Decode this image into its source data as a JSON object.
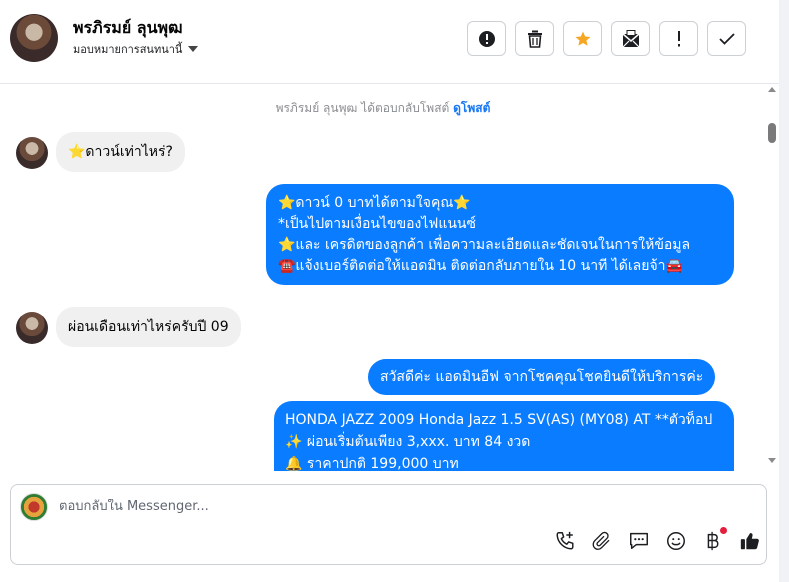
{
  "header": {
    "contact_name": "พรภิรมย์ ลุนพุฒ",
    "assign_label": "มอบหมายการสนทนานี้"
  },
  "thread": {
    "notice_text": "พรภิรมย์ ลุนพุฒ ได้ตอบกลับโพสต์ ",
    "notice_link": "ดูโพสต์",
    "messages": [
      {
        "from": "customer",
        "text": "⭐ดาวน์เท่าไหร่?"
      },
      {
        "from": "page",
        "lines": [
          "⭐ดาวน์ 0 บาทได้ตามใจคุณ⭐",
          "*เป็นไปตามเงื่อนไขของไฟแนนซ์",
          "⭐และ เครดิตของลูกค้า เพื่อความละเอียดและชัดเจนในการให้ข้อมูล",
          "☎️แจ้งเบอร์ติดต่อให้แอดมิน ติดต่อกลับภายใน 10 นาที ได้เลยจ้า🚘"
        ]
      },
      {
        "from": "customer",
        "text": "ผ่อนเดือนเท่าไหร่ครับปี 09"
      },
      {
        "from": "page",
        "text": "สวัสดีค่ะ แอดมินอีฟ จากโชคคุณโชคยินดีให้บริการค่ะ"
      },
      {
        "from": "page",
        "lines": [
          "HONDA JAZZ 2009 Honda Jazz 1.5 SV(AS) (MY08) AT **ตัวท็อป",
          "✨  ผ่อนเริ่มต้นเพียง 3,xxx. บาท 84 งวด",
          "🔔  ราคาปกติ 199,000 บาท"
        ]
      }
    ]
  },
  "composer": {
    "placeholder": "ตอบกลับใน Messenger..."
  },
  "icons": {
    "actions": [
      "alert-circle-icon",
      "trash-icon",
      "star-icon",
      "mark-unread-icon",
      "exclamation-icon",
      "check-icon"
    ],
    "tools": [
      "call-add-icon",
      "paperclip-icon",
      "saved-reply-icon",
      "emoji-icon",
      "baht-icon",
      "thumbs-up-icon"
    ]
  },
  "colors": {
    "outgoing_bubble": "#0a7cff",
    "incoming_bubble": "#f0f0f0",
    "star_active": "#f5a623",
    "link": "#1877f2",
    "notification_dot": "#e41e3f"
  }
}
